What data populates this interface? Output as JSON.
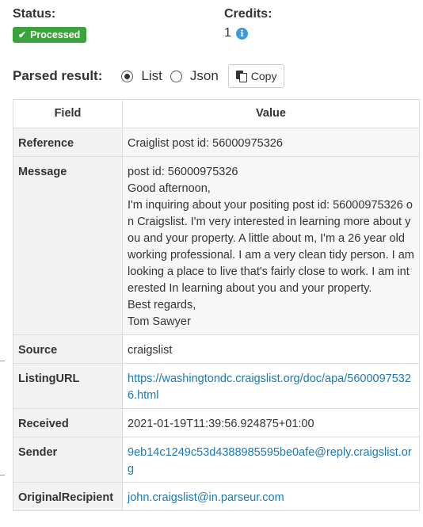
{
  "status": {
    "label": "Status:",
    "badge": "Processed"
  },
  "credits": {
    "label": "Credits:",
    "value": "1"
  },
  "parsed": {
    "label": "Parsed result:",
    "options": [
      "List",
      "Json"
    ],
    "selected": "List",
    "copy_label": "Copy"
  },
  "table": {
    "headers": {
      "field": "Field",
      "value": "Value"
    },
    "rows": [
      {
        "field": "Reference",
        "value": "Craiglist post id: 56000975326"
      },
      {
        "field": "Message",
        "lines": [
          "post id: 56000975326",
          "Good afternoon,",
          "I'm inquiring about your positing post id: 56000975326 on Craigslist. I'm very interested in learning more about you and your property. A little about m, I'm a 26 year old working professional. I am a very clean tidy person. I am looking a place to live that's fairly close to work. I am interested In learning about you and your property.",
          "Best regards,",
          "Tom Sawyer"
        ]
      },
      {
        "field": "Source",
        "value": "craigslist"
      },
      {
        "field": "ListingURL",
        "value": "https://washingtondc.craigslist.org/doc/apa/56000975326.html"
      },
      {
        "field": "Received",
        "value": "2021-01-19T11:39:56.924875+01:00"
      },
      {
        "field": "Sender",
        "value": "9eb14c1249c53d4388985595be0afe@reply.craigslist.org"
      },
      {
        "field": "OriginalRecipient",
        "value": "john.craigslist@in.parseur.com"
      }
    ]
  },
  "colors": {
    "badge": "#3aa33a",
    "link": "#1a7ab5",
    "info": "#3b9ad9"
  }
}
